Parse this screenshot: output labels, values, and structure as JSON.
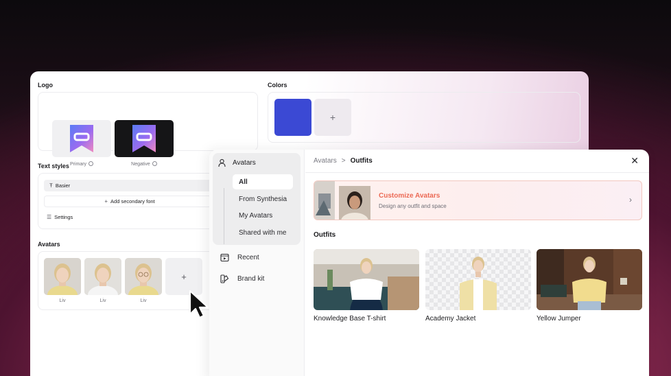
{
  "brand": {
    "logo_label": "Logo",
    "logo_primary_caption": "Primary",
    "logo_negative_caption": "Negative",
    "colors_label": "Colors",
    "color_swatch": "#3b49d4",
    "color_add": "+",
    "text_styles_label": "Text styles",
    "font_basier": "Basier",
    "add_secondary_font": "Add secondary font",
    "settings": "Settings",
    "avatars_label": "Avatars",
    "avatar_names": [
      "Liv",
      "Liv",
      "Liv"
    ],
    "avatar_add": "+"
  },
  "picker": {
    "sidebar": {
      "group_label": "Avatars",
      "items": [
        "All",
        "From Synthesia",
        "My Avatars",
        "Shared with me"
      ],
      "active": "All",
      "recent": "Recent",
      "brand_kit": "Brand kit"
    },
    "breadcrumb": {
      "parent": "Avatars",
      "separator": ">",
      "current": "Outfits"
    },
    "close": "✕",
    "banner": {
      "title": "Customize Avatars",
      "subtitle": "Design any outfit and space",
      "chevron": "›",
      "accent": "#ec6a55"
    },
    "outfits_title": "Outfits",
    "outfits": [
      {
        "name": "Knowledge Base T-shirt"
      },
      {
        "name": "Academy Jacket"
      },
      {
        "name": "Yellow Jumper"
      }
    ]
  }
}
